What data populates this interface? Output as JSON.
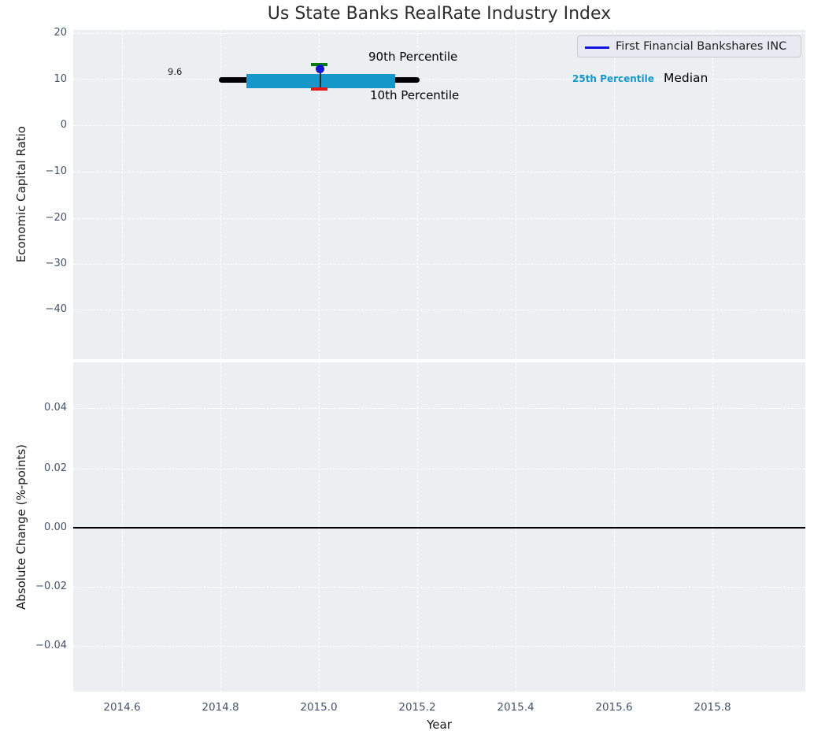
{
  "title": "Us State Banks RealRate Industry Index",
  "legend": {
    "entries": [
      {
        "label": "First Financial Bankshares INC",
        "color": "#1010e8"
      }
    ]
  },
  "chart_data": [
    {
      "type": "box",
      "title": "Us State Banks RealRate Industry Index",
      "ylabel": "Economic Capital Ratio",
      "ylim": [
        -51,
        20.5
      ],
      "yticks": [
        20,
        10,
        0,
        -10,
        -20,
        -30,
        -40
      ],
      "ytick_labels": [
        "20",
        "10",
        "0",
        "−10",
        "−20",
        "−30",
        "−40"
      ],
      "grid": true,
      "legend_position": "upper right",
      "series": [
        {
          "name": "First Financial Bankshares INC",
          "x": [
            2015.0
          ],
          "values": [
            12.4
          ],
          "marker": "circle",
          "marker_color": "#1414cc",
          "line_color": "#1010e8"
        }
      ],
      "industry_percentiles": {
        "year": 2015.0,
        "median": 9.6,
        "p90": 13.4,
        "p75": 11.2,
        "p25": 8.1,
        "p10": 7.9,
        "median_span_years": [
          2014.8,
          2015.2
        ],
        "iqr_span_years": [
          2014.85,
          2015.15
        ],
        "band_color": "#1697c9",
        "p90_cap_color": "#007d00",
        "p10_cap_color": "#e81717",
        "median_color": "#000000"
      },
      "annotations": {
        "p90_label": "90th Percentile",
        "p10_label": "10th Percentile",
        "p25_label": "25th Percentile",
        "median_label": "Median",
        "median_value_label": "9.6"
      }
    },
    {
      "type": "line",
      "ylabel": "Absolute Change (%-points)",
      "xlabel": "Year",
      "ylim": [
        -0.056,
        0.052
      ],
      "xlim": [
        2014.5,
        2015.99
      ],
      "yticks": [
        0.04,
        0.02,
        0.0,
        -0.02,
        -0.04
      ],
      "ytick_labels": [
        "0.04",
        "0.02",
        "0.00",
        "−0.02",
        "−0.04"
      ],
      "xticks": [
        2014.6,
        2014.8,
        2015.0,
        2015.2,
        2015.4,
        2015.6,
        2015.8
      ],
      "xtick_labels": [
        "2014.6",
        "2014.8",
        "2015.0",
        "2015.2",
        "2015.4",
        "2015.6",
        "2015.8"
      ],
      "zero_line": 0.0,
      "grid": true,
      "series": []
    }
  ]
}
